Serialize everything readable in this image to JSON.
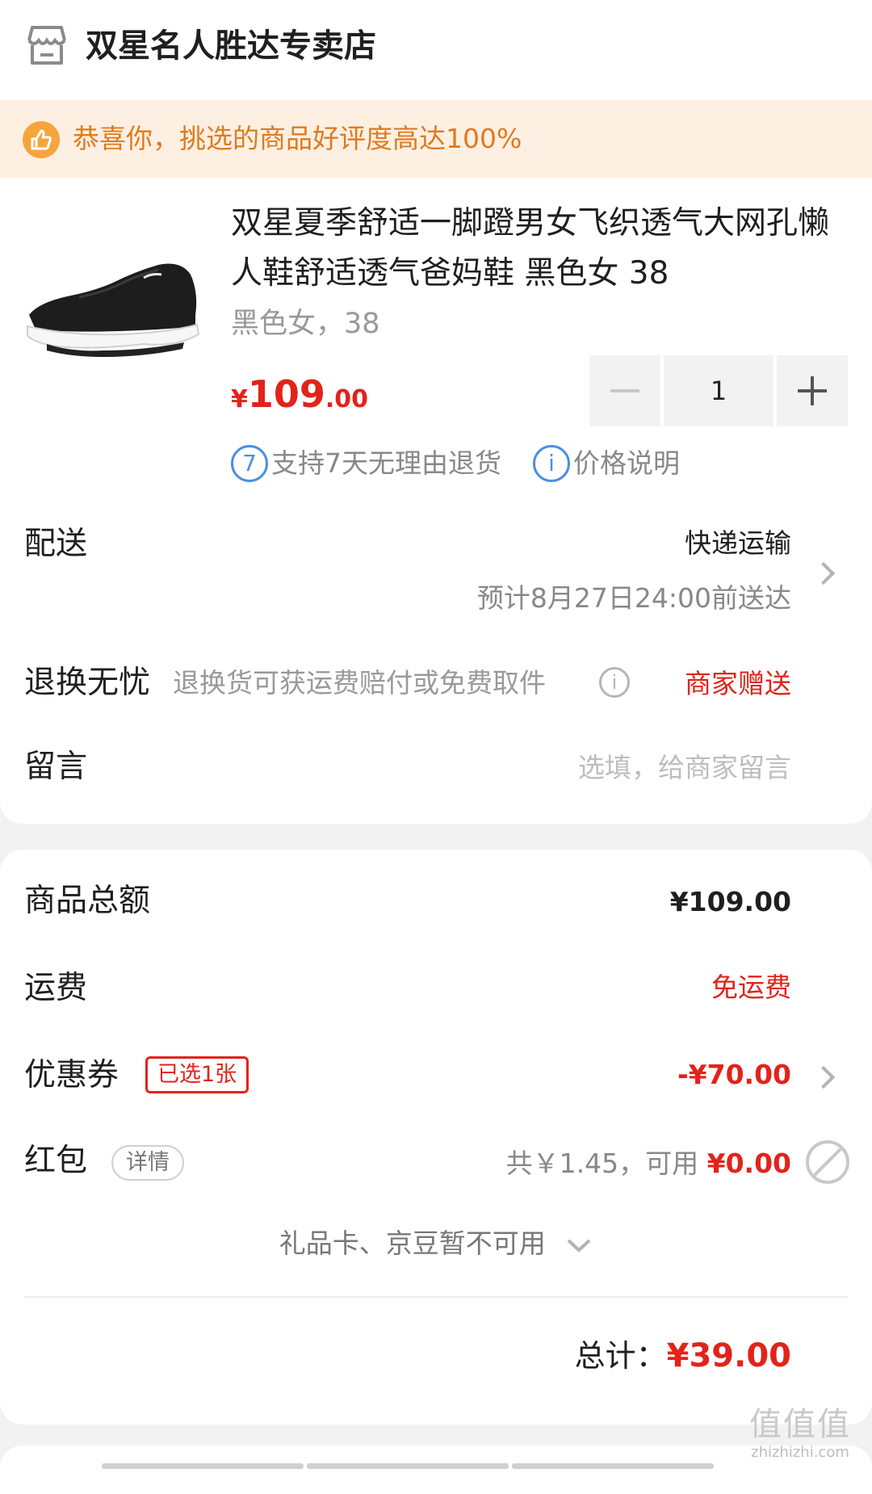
{
  "store": {
    "name": "双星名人胜达专卖店",
    "icon": "store-icon"
  },
  "banner": {
    "icon": "thumbs-up-icon",
    "text": "恭喜你，挑选的商品好评度高达100%"
  },
  "product": {
    "title": "双星夏季舒适一脚蹬男女飞织透气大网孔懒人鞋舒适透气爸妈鞋 黑色女 38",
    "spec": "黑色女，38",
    "price": {
      "currency": "¥",
      "integer": "109",
      "decimal": ".00"
    },
    "quantity": "1",
    "services": [
      {
        "icon": "7",
        "label": "支持7天无理由退货"
      },
      {
        "icon": "i",
        "label": "价格说明"
      }
    ]
  },
  "delivery": {
    "label": "配送",
    "method": "快递运输",
    "eta": "预计8月27日24:00前送达"
  },
  "returns": {
    "label": "退换无忧",
    "desc": "退换货可获运费赔付或免费取件",
    "value": "商家赠送"
  },
  "message": {
    "label": "留言",
    "placeholder": "选填，给商家留言"
  },
  "summary": {
    "goods_total_label": "商品总额",
    "goods_total": "¥109.00",
    "shipping_label": "运费",
    "shipping_value": "免运费",
    "coupon_label": "优惠券",
    "coupon_badge": "已选1张",
    "coupon_value": "-¥70.00",
    "redpacket_label": "红包",
    "redpacket_badge": "详情",
    "redpacket_desc": "共￥1.45，可用",
    "redpacket_value": "¥0.00",
    "gift_note": "礼品卡、京豆暂不可用",
    "total_label": "总计：",
    "total_value": "¥39.00"
  },
  "watermark": {
    "logo": "值值值",
    "site": "zhizhizhi.com"
  },
  "colors": {
    "price_red": "#e2231a",
    "banner_bg": "#fdf0e2",
    "banner_text": "#e07a1f",
    "link_blue": "#4a90e2"
  }
}
